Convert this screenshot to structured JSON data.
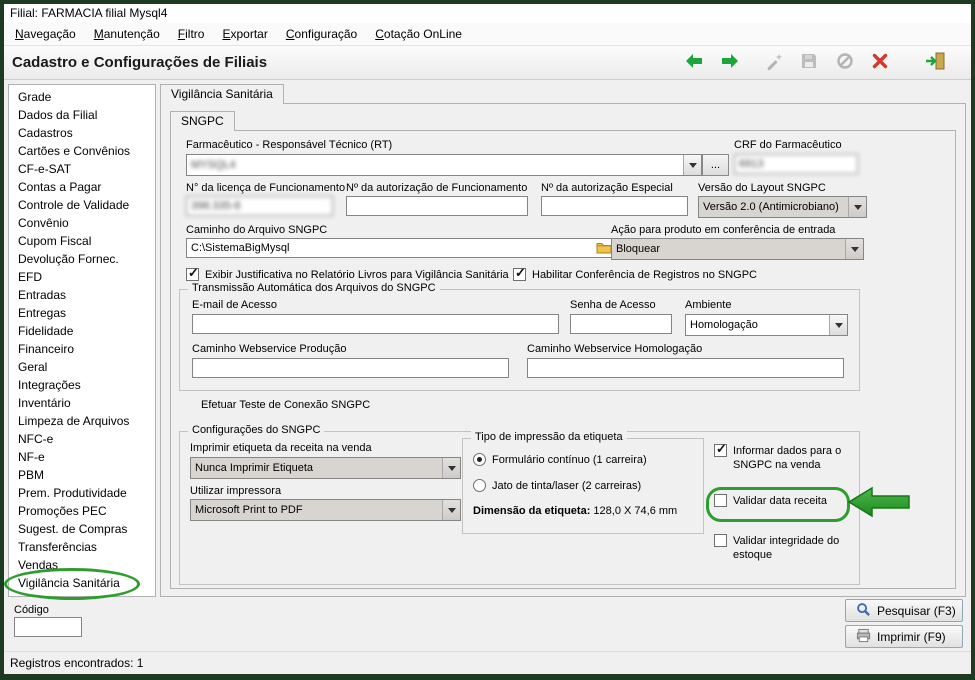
{
  "window": {
    "title": "Filial: FARMACIA filial Mysql4",
    "status": "Registros encontrados: 1"
  },
  "menu": {
    "items": [
      "Navegação",
      "Manutenção",
      "Filtro",
      "Exportar",
      "Configuração",
      "Cotação OnLine"
    ]
  },
  "header": {
    "title": "Cadastro e Configurações de Filiais"
  },
  "toolbar": {
    "icons": [
      "back",
      "forward",
      "wand",
      "save",
      "block",
      "delete",
      "exit"
    ]
  },
  "sidebar": {
    "selected": "Vigilância Sanitária",
    "items": [
      "Grade",
      "Dados da Filial",
      "Cadastros",
      "Cartões e Convênios",
      "CF-e-SAT",
      "Contas a Pagar",
      "Controle de Validade",
      "Convênio",
      "Cupom Fiscal",
      "Devolução Fornec.",
      "EFD",
      "Entradas",
      "Entregas",
      "Fidelidade",
      "Financeiro",
      "Geral",
      "Integrações",
      "Inventário",
      "Limpeza de Arquivos",
      "NFC-e",
      "NF-e",
      "PBM",
      "Prem. Produtividade",
      "Promoções PEC",
      "Sugest. de Compras",
      "Transferências",
      "Vendas",
      "Vigilância Sanitária"
    ]
  },
  "tabs": {
    "main": "Vigilância Sanitária",
    "inner": "SNGPC"
  },
  "form": {
    "rt": {
      "label": "Farmacêutico - Responsável Técnico (RT)",
      "value": "MYSQL4",
      "redacted": true,
      "browse": "..."
    },
    "crf": {
      "label": "CRF do Farmacêutico",
      "value": "6913",
      "redacted": true
    },
    "licenca": {
      "label": "N° da licença de Funcionamento",
      "value": "398.335-8",
      "redacted": true
    },
    "aut_funcionamento": {
      "label": "Nº da autorização de Funcionamento",
      "value": ""
    },
    "aut_especial": {
      "label": "Nº da autorização Especial",
      "value": ""
    },
    "layout": {
      "label": "Versão do Layout SNGPC",
      "value": "Versão 2.0 (Antimicrobiano)"
    },
    "caminho": {
      "label": "Caminho do Arquivo SNGPC",
      "value": "C:\\SistemaBigMysql"
    },
    "acao": {
      "label": "Ação para produto em conferência de entrada",
      "value": "Bloquear"
    },
    "cb_justificativa": {
      "label": "Exibir Justificativa no Relatório Livros para Vigilância Sanitária",
      "checked": true
    },
    "cb_conferencia": {
      "label": "Habilitar Conferência de Registros no SNGPC",
      "checked": true
    }
  },
  "transmissao": {
    "title": "Transmissão Automática dos Arquivos do SNGPC",
    "email_label": "E-mail de Acesso",
    "email_value": "",
    "senha_label": "Senha de Acesso",
    "senha_value": "",
    "ambiente_label": "Ambiente",
    "ambiente_value": "Homologação",
    "ws_producao_label": "Caminho Webservice Produção",
    "ws_producao_value": "",
    "ws_homologacao_label": "Caminho Webservice Homologação",
    "ws_homologacao_value": "",
    "teste_conexao": "Efetuar Teste de Conexão SNGPC"
  },
  "configuracoes": {
    "title": "Configurações do SNGPC",
    "imprimir_label": "Imprimir etiqueta da receita na venda",
    "imprimir_value": "Nunca Imprimir Etiqueta",
    "impressora_label": "Utilizar impressora",
    "impressora_value": "Microsoft Print to PDF",
    "tipo": {
      "title": "Tipo de impressão da etiqueta",
      "opcao1": "Formulário contínuo (1 carreira)",
      "opcao1_selected": true,
      "opcao2": "Jato de tinta/laser (2 carreiras)",
      "opcao2_selected": false,
      "dimensao_label": "Dimensão da etiqueta:",
      "dimensao_value": "128,0 X 74,6 mm"
    },
    "cb_informar": {
      "label": "Informar dados para o SNGPC na venda",
      "checked": true
    },
    "cb_validar_data": {
      "label": "Validar data receita",
      "checked": false
    },
    "cb_validar_estoque": {
      "label": "Validar integridade do estoque",
      "checked": false
    }
  },
  "footer": {
    "codigo_label": "Código",
    "codigo_value": "",
    "pesquisar": "Pesquisar (F3)",
    "imprimir": "Imprimir (F9)"
  },
  "colors": {
    "annotation_green": "#2e9c2e",
    "toolbar_green": "#1ca53a",
    "close_red": "#d23a2e",
    "frame_green": "#1e3b22"
  }
}
